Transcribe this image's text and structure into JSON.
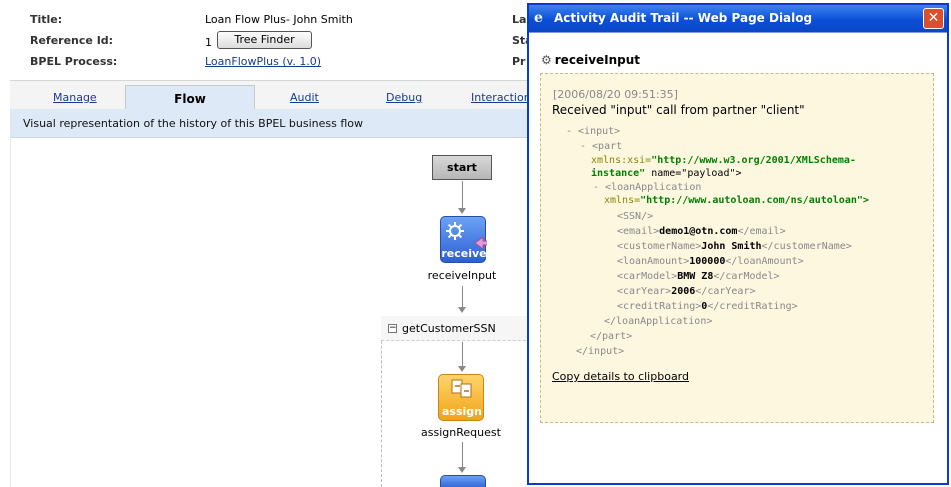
{
  "info": {
    "title_label": "Title:",
    "title_value": "Loan Flow Plus- John Smith",
    "ref_label": "Reference Id:",
    "ref_value": "1",
    "tree_finder_label": "Tree Finder",
    "bpel_label": "BPEL Process:",
    "bpel_value": "LoanFlowPlus (v. 1.0)",
    "right_labels": [
      "La",
      "Sta",
      "Pr"
    ]
  },
  "tabs": [
    {
      "label": "Manage"
    },
    {
      "label": "Flow",
      "active": true
    },
    {
      "label": "Audit"
    },
    {
      "label": "Debug"
    },
    {
      "label": "Interaction"
    }
  ],
  "description": "Visual representation of the history of this BPEL business flow",
  "flow": {
    "start_label": "start",
    "receive_icon_text": "receive",
    "receive_label": "receiveInput",
    "scope_title": "getCustomerSSN",
    "assign_icon_text": "assign",
    "assign_label": "assignRequest"
  },
  "dialog": {
    "title": "Activity Audit Trail -- Web Page Dialog",
    "close_symbol": "✕",
    "activity_name": "receiveInput",
    "timestamp": "[2006/08/20 09:51:35]",
    "message": "Received \"input\" call from partner \"client\"",
    "copy_link": "Copy details to clipboard",
    "xml": {
      "input_open": "- <input>",
      "part_open": "- <part",
      "xsi_attr": "xmlns:xsi=",
      "xsi_val_1": "\"http://www.w3.org/2001/XMLSchema-",
      "xsi_val_2": "instance\"",
      "name_attr": " name=\"payload\">",
      "loan_open": "- <loanApplication",
      "loan_ns_attr": "xmlns=",
      "loan_ns_val": "\"http://www.autoloan.com/ns/autoloan\">",
      "ssn": "<SSN/>",
      "email_open": "<email>",
      "email_val": "demo1@otn.com",
      "email_close": "</email>",
      "cust_open": "<customerName>",
      "cust_val": "John Smith",
      "cust_close": "</customerName>",
      "amt_open": "<loanAmount>",
      "amt_val": "100000",
      "amt_close": "</loanAmount>",
      "model_open": "<carModel>",
      "model_val": "BMW Z8",
      "model_close": "</carModel>",
      "year_open": "<carYear>",
      "year_val": "2006",
      "year_close": "</carYear>",
      "credit_open": "<creditRating>",
      "credit_val": "0",
      "credit_close": "</creditRating>",
      "loan_close": "</loanApplication>",
      "part_close": "</part>",
      "input_close": "</input>"
    }
  }
}
